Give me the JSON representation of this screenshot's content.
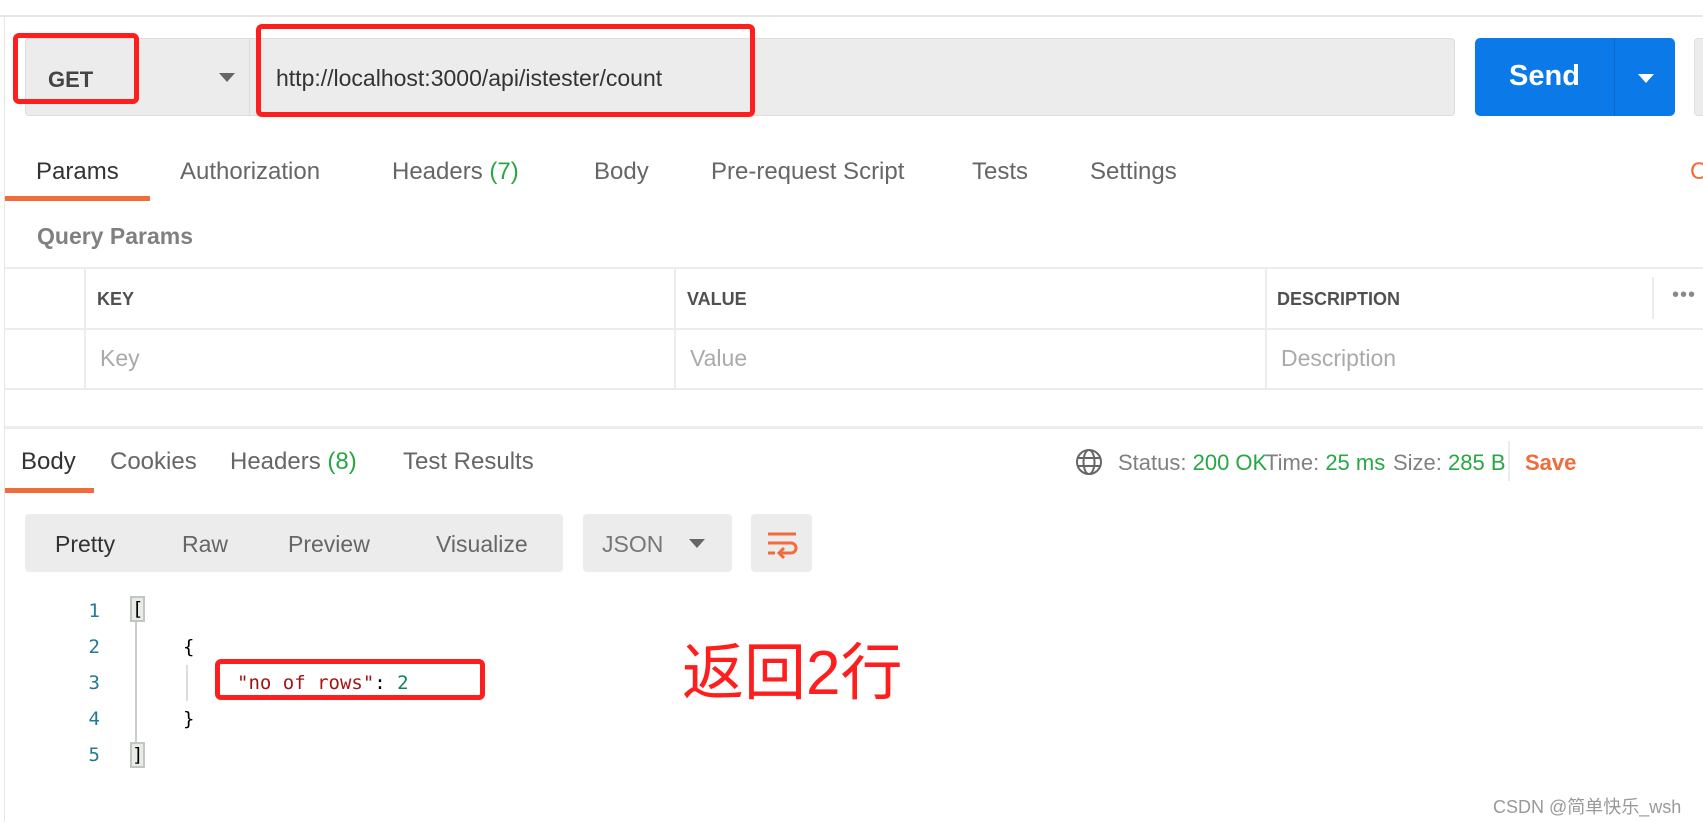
{
  "request": {
    "method": "GET",
    "url": "http://localhost:3000/api/istester/count",
    "send_label": "Send"
  },
  "request_tabs": [
    {
      "label": "Params",
      "active": true
    },
    {
      "label": "Authorization"
    },
    {
      "label": "Headers",
      "count": "(7)"
    },
    {
      "label": "Body"
    },
    {
      "label": "Pre-request Script"
    },
    {
      "label": "Tests"
    },
    {
      "label": "Settings"
    }
  ],
  "cookies_partial": "C",
  "query_params": {
    "title": "Query Params",
    "columns": [
      "KEY",
      "VALUE",
      "DESCRIPTION"
    ],
    "placeholders": [
      "Key",
      "Value",
      "Description"
    ],
    "more": "•••"
  },
  "response_tabs": [
    {
      "label": "Body",
      "active": true
    },
    {
      "label": "Cookies"
    },
    {
      "label": "Headers",
      "count": "(8)"
    },
    {
      "label": "Test Results"
    }
  ],
  "status": {
    "status_label": "Status:",
    "status_value": "200 OK",
    "time_label": "Time:",
    "time_value": "25 ms",
    "size_label": "Size:",
    "size_value": "285 B",
    "save_label": "Save"
  },
  "view_modes": [
    "Pretty",
    "Raw",
    "Preview",
    "Visualize"
  ],
  "format": "JSON",
  "code": {
    "line_numbers": [
      "1",
      "2",
      "3",
      "4",
      "5"
    ],
    "open_bracket": "[",
    "open_brace": "{",
    "key": "\"no of rows\"",
    "colon": ": ",
    "value": "2",
    "close_brace": "}",
    "close_bracket": "]"
  },
  "annotation": "返回2行",
  "watermark": "CSDN @简单快乐_wsh",
  "colors": {
    "accent": "#f26b3a",
    "send": "#0b7ae8",
    "success": "#28a745",
    "annotation": "#ff1e1e"
  }
}
